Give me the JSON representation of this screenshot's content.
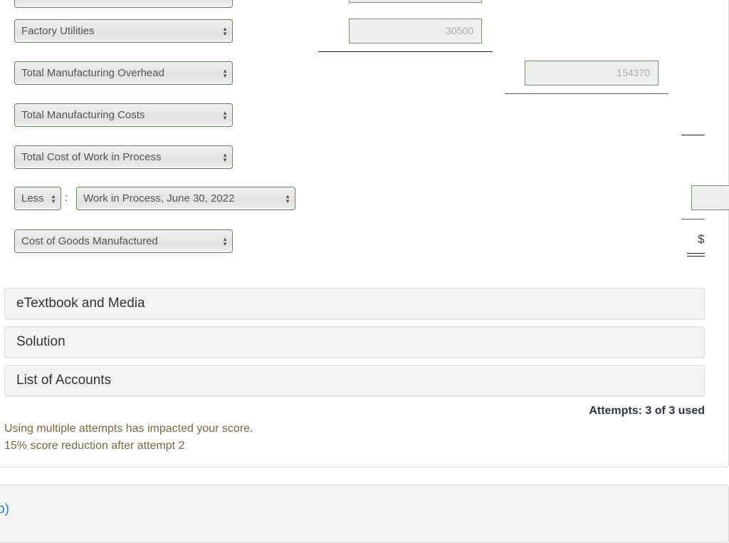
{
  "rows": {
    "factory_utilities": {
      "label": "Factory Utilities",
      "amount": "30500"
    },
    "total_mfg_overhead": {
      "label": "Total Manufacturing Overhead",
      "amount": "154370"
    },
    "total_mfg_costs": {
      "label": "Total Manufacturing Costs"
    },
    "total_cost_wip": {
      "label": "Total Cost of Work in Process"
    },
    "less_wip": {
      "prefix": "Less",
      "separator": ":",
      "label": "Work in Process, June 30, 2022",
      "amount": ""
    },
    "cogm": {
      "label": "Cost of Goods Manufactured",
      "currency": "$"
    }
  },
  "accordions": [
    {
      "label": "eTextbook and Media"
    },
    {
      "label": "Solution"
    },
    {
      "label": "List of Accounts"
    }
  ],
  "attempts": "Attempts: 3 of 3 used",
  "notice": {
    "line1": "Using multiple attempts has impacted your score.",
    "line2": "15% score reduction after attempt 2"
  },
  "next_part": {
    "label": "b)"
  },
  "colors": {
    "input_border": "#5a8a4e",
    "notice_text": "#7a6840",
    "link": "#2f7fd6"
  }
}
